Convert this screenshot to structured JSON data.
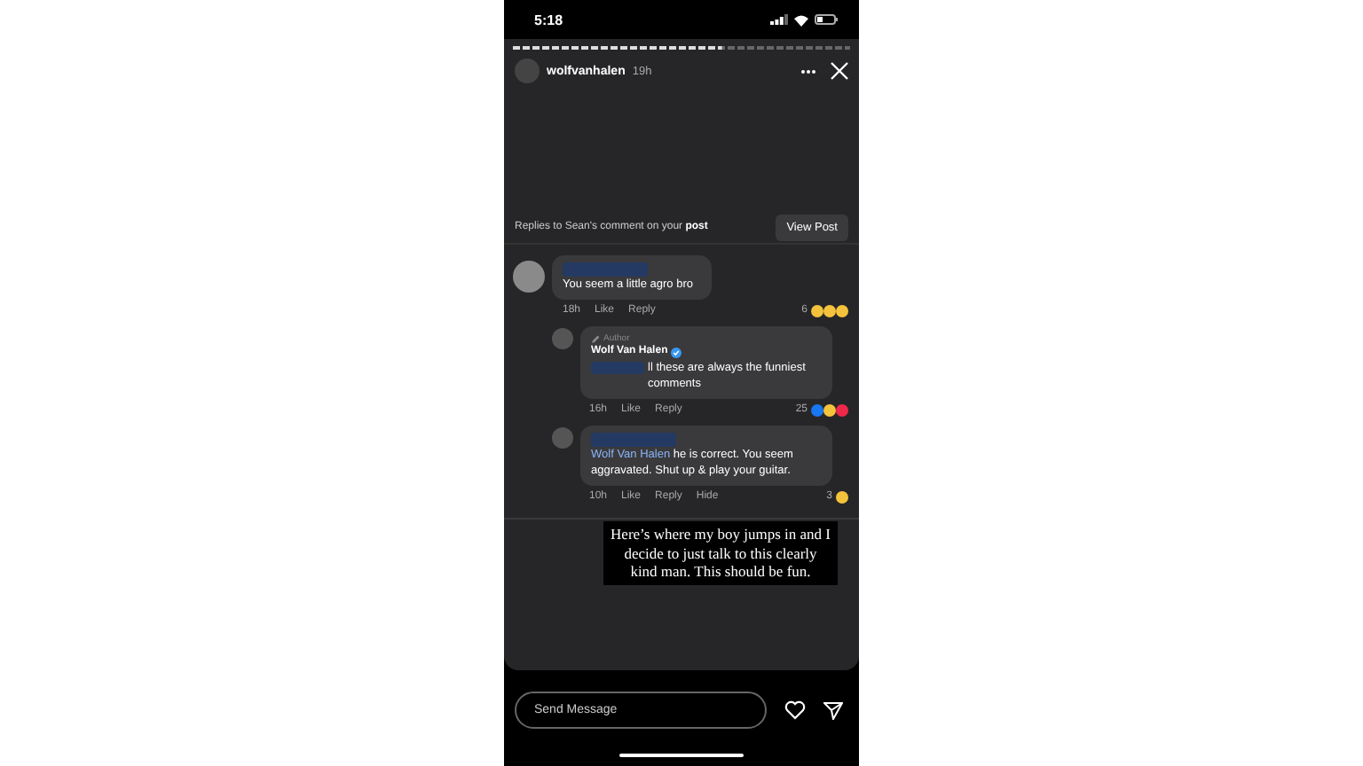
{
  "status_bar": {
    "time": "5:18"
  },
  "story_progress": {
    "level": 0.62
  },
  "header": {
    "username": "wolfvanhalen",
    "time": "19h"
  },
  "reply_banner": {
    "text": "Replies to Sean's comment on your **post**",
    "button": "View Post"
  },
  "comments": [
    {
      "kind": "top",
      "name_redacted": true,
      "text": "You seem a little agro bro",
      "time": "18h",
      "actions": [
        "Like",
        "Reply"
      ],
      "reaction_count": "6",
      "reactions": [
        {
          "kind": "laugh"
        },
        {
          "kind": "wow"
        },
        {
          "kind": "cry"
        }
      ]
    },
    {
      "kind": "reply",
      "author_label": "Author",
      "name": "Wolf Van Halen",
      "verified": true,
      "text_redacted_prefix": true,
      "text": "ll these are always the funniest comments",
      "time": "16h",
      "actions": [
        "Like",
        "Reply"
      ],
      "reaction_count": "25",
      "reactions": [
        {
          "kind": "like"
        },
        {
          "kind": "laugh"
        },
        {
          "kind": "love"
        }
      ]
    },
    {
      "kind": "reply",
      "name_redacted": true,
      "mention": "Wolf Van Halen",
      "text": "he is correct. You seem aggravated. Shut up & play your guitar.",
      "time": "10h",
      "actions": [
        "Like",
        "Reply",
        "Hide"
      ],
      "reaction_count": "3",
      "reactions": [
        {
          "kind": "wow"
        }
      ]
    }
  ],
  "caption": "Here’s where my boy jumps in and I decide to just talk to this clearly kind man. This should be fun.",
  "message_bar": {
    "placeholder": "Send Message"
  }
}
